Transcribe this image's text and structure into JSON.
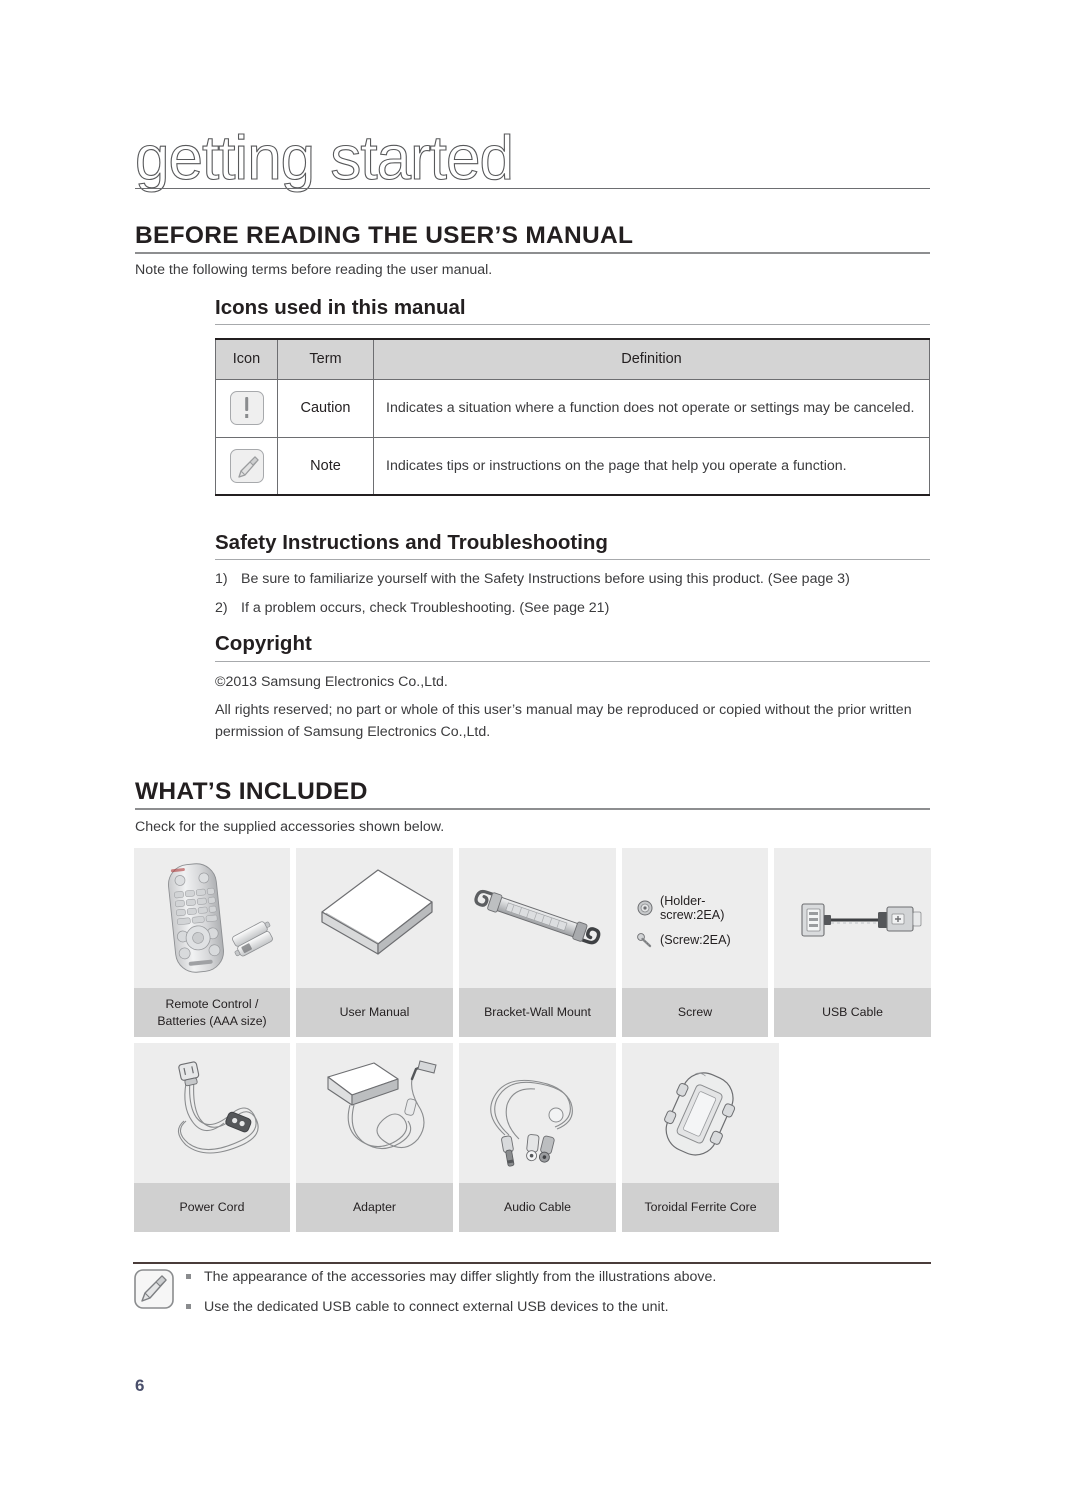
{
  "chapter": {
    "title": "getting started"
  },
  "section1": {
    "heading": "BEFORE READING THE USER’S MANUAL",
    "intro": "Note the following terms before reading the user manual.",
    "icons_sub": {
      "heading": "Icons used in this manual",
      "table": {
        "headers": [
          "Icon",
          "Term",
          "Definition"
        ],
        "rows": [
          {
            "icon": "caution-icon",
            "term": "Caution",
            "definition": "Indicates a situation where a function does not operate or settings may be canceled."
          },
          {
            "icon": "note-icon",
            "term": "Note",
            "definition": "Indicates tips or instructions on the page that help you operate a function."
          }
        ]
      }
    },
    "safety_sub": {
      "heading": "Safety Instructions and Troubleshooting",
      "items": [
        {
          "num": "1)",
          "text": "Be sure to familiarize yourself with the Safety Instructions before using this product. (See page 3)"
        },
        {
          "num": "2)",
          "text": "If a problem occurs, check Troubleshooting. (See page 21)"
        }
      ]
    },
    "copyright_sub": {
      "heading": "Copyright",
      "line1": "©2013 Samsung Electronics Co.,Ltd.",
      "line2": "All rights reserved; no part or whole of this user’s manual may be reproduced or copied without the prior written permission of Samsung Electronics Co.,Ltd."
    }
  },
  "section2": {
    "heading": "WHAT’S INCLUDED",
    "intro": "Check for the supplied accessories shown below.",
    "accessories": {
      "row1": [
        {
          "label": "Remote Control /\nBatteries (AAA size)",
          "art": "remote-control"
        },
        {
          "label": "User Manual",
          "art": "user-manual"
        },
        {
          "label": "Bracket-Wall Mount",
          "art": "wall-bracket"
        },
        {
          "label": "Screw",
          "art": "screws",
          "annotations": [
            "(Holder-screw:2EA)",
            "(Screw:2EA)"
          ]
        },
        {
          "label": "USB Cable",
          "art": "usb-cable"
        }
      ],
      "row2": [
        {
          "label": "Power Cord",
          "art": "power-cord"
        },
        {
          "label": "Adapter",
          "art": "adapter"
        },
        {
          "label": "Audio Cable",
          "art": "audio-cable"
        },
        {
          "label": "Toroidal Ferrite Core",
          "art": "ferrite-core"
        }
      ]
    }
  },
  "bottom_note": {
    "icon": "note-icon",
    "items": [
      "The appearance of the accessories may differ slightly from the illustrations above.",
      "Use the dedicated USB cable to connect external USB devices to the unit."
    ]
  },
  "page_number": "6",
  "colors": {
    "text": "#231f20",
    "body_text": "#3b3b3d",
    "rule": "#8d8e90",
    "table_header_bg": "#d4d4d4",
    "cell_bg": "#ededed",
    "label_bg": "#d0d0d0",
    "page_number": "#4a4f6b"
  }
}
